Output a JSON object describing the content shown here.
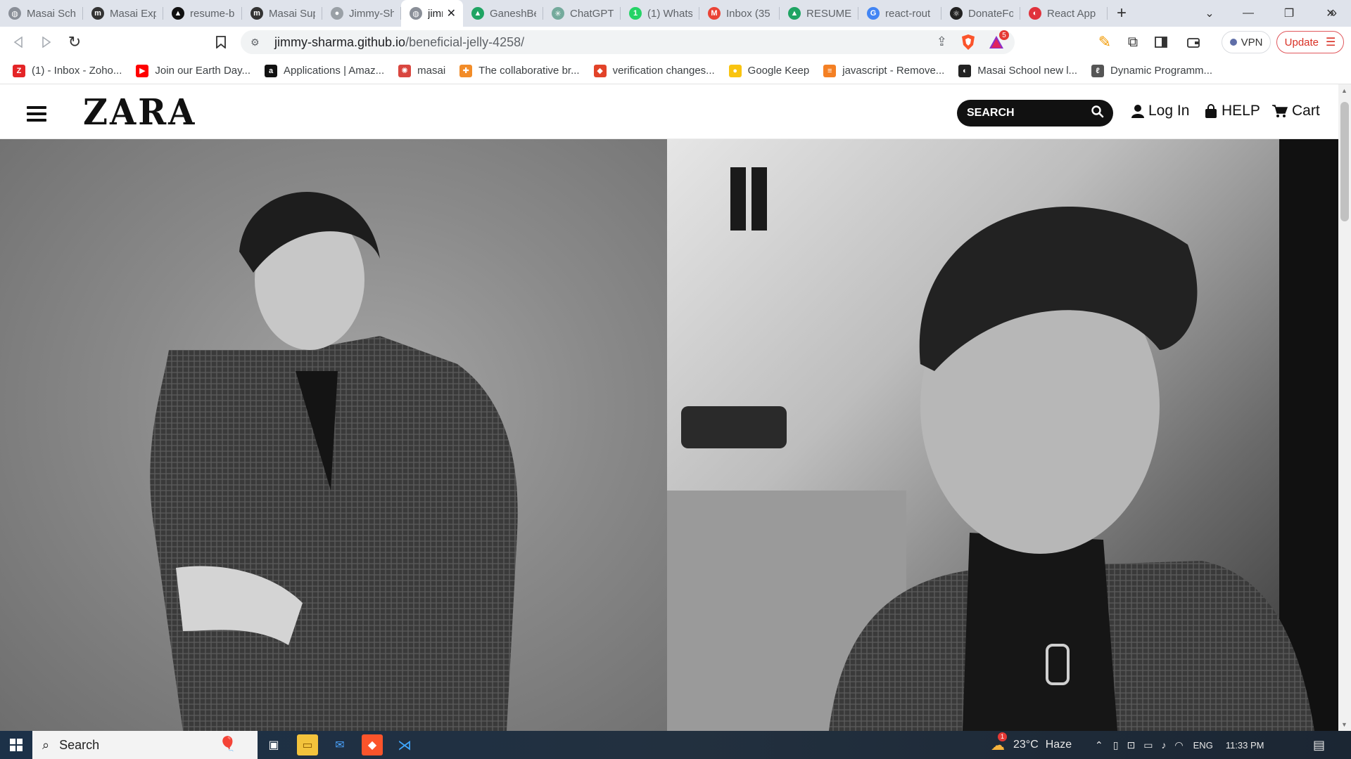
{
  "browser": {
    "tabs": [
      {
        "title": "Masai Sch",
        "favicon": "globe-icon",
        "color": "#8a8f98"
      },
      {
        "title": "Masai Exp",
        "favicon": "masai-m-icon",
        "color": "#333333"
      },
      {
        "title": "resume-b",
        "favicon": "triangle-logo-icon",
        "color": "#111111"
      },
      {
        "title": "Masai Sup",
        "favicon": "masai-m-icon",
        "color": "#333333"
      },
      {
        "title": "Jimmy-Sh",
        "favicon": "github-icon",
        "color": "#9aa0a6"
      },
      {
        "title": "jimm",
        "favicon": "globe-icon",
        "color": "#8a8f98",
        "active": true
      },
      {
        "title": "GaneshBe",
        "favicon": "drive-icon",
        "color": "#1fa463"
      },
      {
        "title": "ChatGPT",
        "favicon": "chatgpt-icon",
        "color": "#74aa9c"
      },
      {
        "title": "(1) Whats",
        "favicon": "whatsapp-icon",
        "color": "#25d366"
      },
      {
        "title": "Inbox (35",
        "favicon": "gmail-icon",
        "color": "#ea4335"
      },
      {
        "title": "RESUME -",
        "favicon": "drive-icon",
        "color": "#1fa463"
      },
      {
        "title": "react-rout",
        "favicon": "google-icon",
        "color": "#4285f4"
      },
      {
        "title": "DonateFo",
        "favicon": "react-icon",
        "color": "#222222"
      },
      {
        "title": "React App",
        "favicon": "react-app-icon",
        "color": "#e0323c"
      }
    ],
    "address": {
      "host": "jimmy-sharma.github.io",
      "path": "/beneficial-jelly-4258/"
    },
    "brave_badge": "5",
    "vpn_label": "VPN",
    "update_label": "Update",
    "bookmarks": [
      {
        "label": "(1) - Inbox - Zoho...",
        "icon": "zoho-icon",
        "color": "#e42527"
      },
      {
        "label": "Join our Earth Day...",
        "icon": "youtube-icon",
        "color": "#ff0000"
      },
      {
        "label": "Applications | Amaz...",
        "icon": "amazon-icon",
        "color": "#111111"
      },
      {
        "label": "masai",
        "icon": "masai-icon",
        "color": "#d9463f"
      },
      {
        "label": "The collaborative br...",
        "icon": "collab-icon",
        "color": "#f28c28"
      },
      {
        "label": "verification changes...",
        "icon": "gitlab-icon",
        "color": "#e24329"
      },
      {
        "label": "Google Keep",
        "icon": "keep-icon",
        "color": "#f9c410"
      },
      {
        "label": "javascript - Remove...",
        "icon": "stackoverflow-icon",
        "color": "#f48024"
      },
      {
        "label": "Masai School new l...",
        "icon": "masai-dark-icon",
        "color": "#222222"
      },
      {
        "label": "Dynamic Programm...",
        "icon": "dp-icon",
        "color": "#555555"
      }
    ]
  },
  "site": {
    "logo": "ZARA",
    "search_label": "SEARCH",
    "login_label": "Log In",
    "help_label": "HELP",
    "cart_label": "Cart"
  },
  "taskbar": {
    "search_label": "Search",
    "weather_temp": "23°C",
    "weather_desc": "Haze",
    "weather_badge": "1",
    "language": "ENG",
    "time": "11:33 PM"
  }
}
